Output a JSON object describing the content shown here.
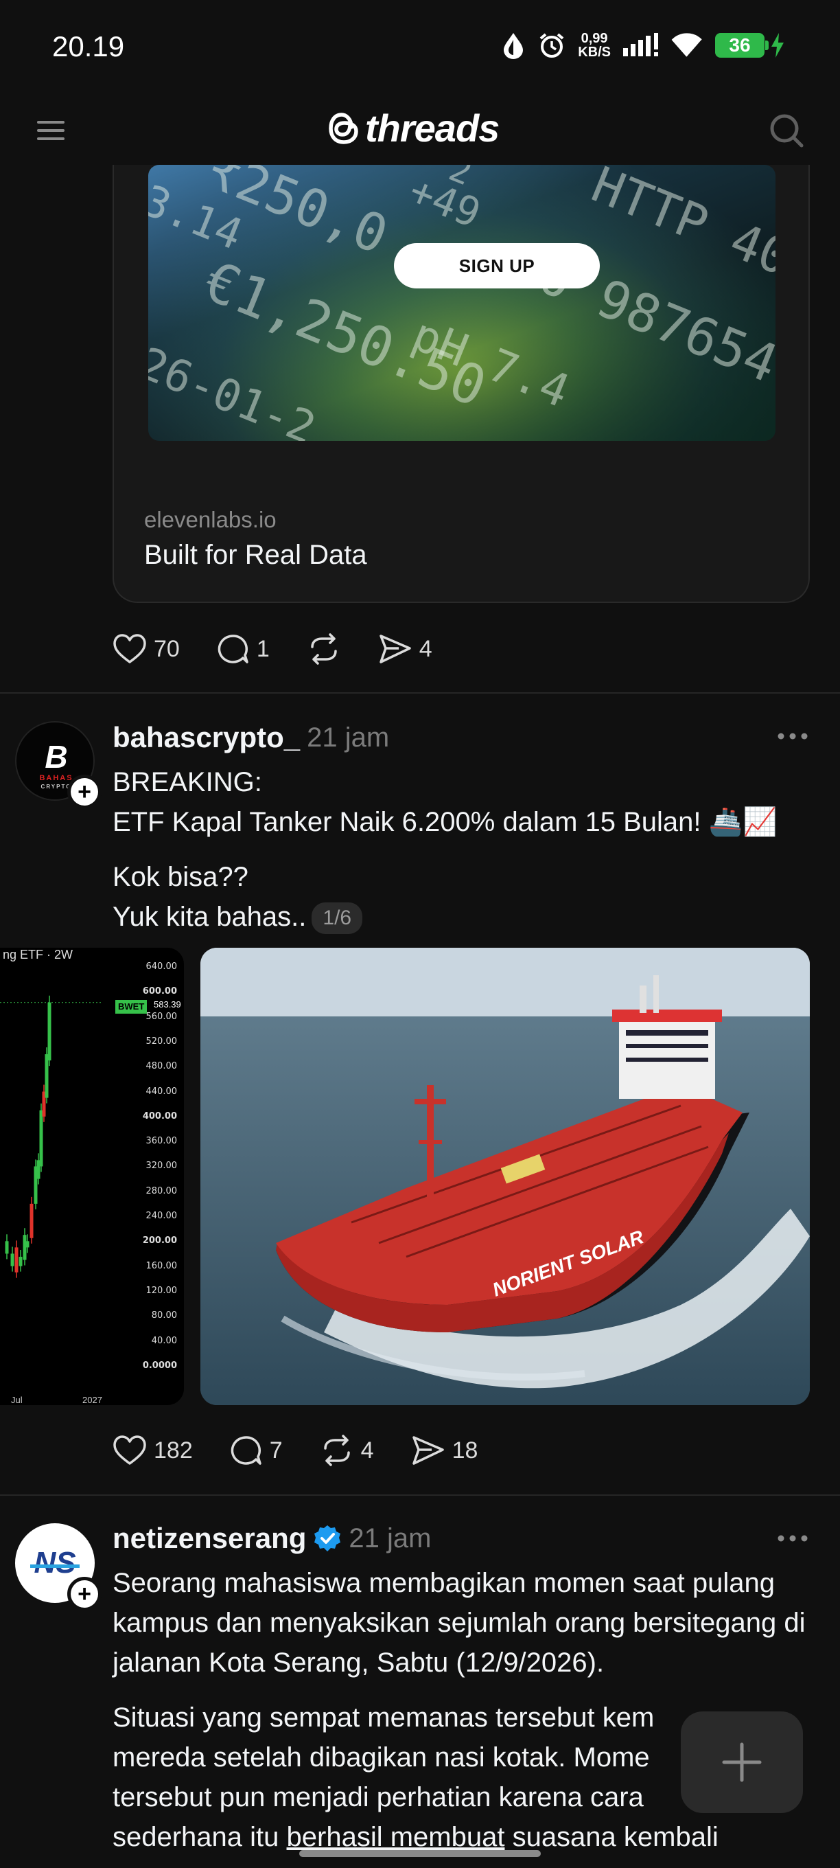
{
  "status_bar": {
    "time": "20.19",
    "net_speed_value": "0,99",
    "net_speed_unit": "KB/S",
    "battery": "36"
  },
  "header": {
    "brand": "threads",
    "menu_icon": "menu-icon",
    "search_icon": "search-icon"
  },
  "post1": {
    "ad": {
      "numbers": [
        "₹250,0",
        "+49",
        "HTTP 40",
        "3.14",
        "€1,250.50",
        "pH 7.4",
        "0 987654",
        "26-01-2",
        "2"
      ],
      "signup_label": "SIGN UP"
    },
    "link_domain": "elevenlabs.io",
    "link_title": "Built for Real Data",
    "likes": "70",
    "replies": "1",
    "shares": "4"
  },
  "post2": {
    "avatar_text_main": "B",
    "avatar_text_sub": "BAHAS",
    "avatar_text_sub2": "CRYPTO",
    "username": "bahascrypto_",
    "time": "21 jam",
    "lines": [
      "BREAKING:",
      "ETF Kapal Tanker Naik 6.200% dalam 15 Bulan! 🚢📈",
      "Kok bisa??",
      "Yuk kita bahas.."
    ],
    "page_indicator": "1/6",
    "chart": {
      "title": "ng ETF · 2W",
      "ticks": [
        "640.00",
        "600.00",
        "560.00",
        "520.00",
        "480.00",
        "440.00",
        "400.00",
        "360.00",
        "320.00",
        "280.00",
        "240.00",
        "200.00",
        "160.00",
        "120.00",
        "80.00",
        "40.00",
        "0.0000"
      ],
      "price_label": "BWET",
      "price_value": "583.39",
      "x_labels": [
        "Jul",
        "2027"
      ]
    },
    "ship_name": "NORIENT SOLAR",
    "likes": "182",
    "replies": "7",
    "reposts": "4",
    "shares": "18"
  },
  "post3": {
    "avatar_text": "NS",
    "username": "netizenserang",
    "verified": true,
    "time": "21 jam",
    "para1": "Seorang mahasiswa membagikan momen saat pulang kampus dan menyaksikan sejumlah orang bersitegang di jalanan Kota Serang, Sabtu (12/9/2026).",
    "para2_a": "Situasi yang sempat memanas tersebut kem",
    "para2_b": "mereda setelah dibagikan nasi kotak. Mome",
    "para2_c": "tersebut pun menjadi perhatian karena cara",
    "para2_d1": "sederhana itu ",
    "para2_d2": "berhasil membuat",
    "para2_d3": " suasana kembali"
  },
  "colors": {
    "background": "#101010",
    "text": "#f3f5f7",
    "muted": "#7b7b7b",
    "verified": "#1d9bf0",
    "battery": "#2fb94a"
  }
}
